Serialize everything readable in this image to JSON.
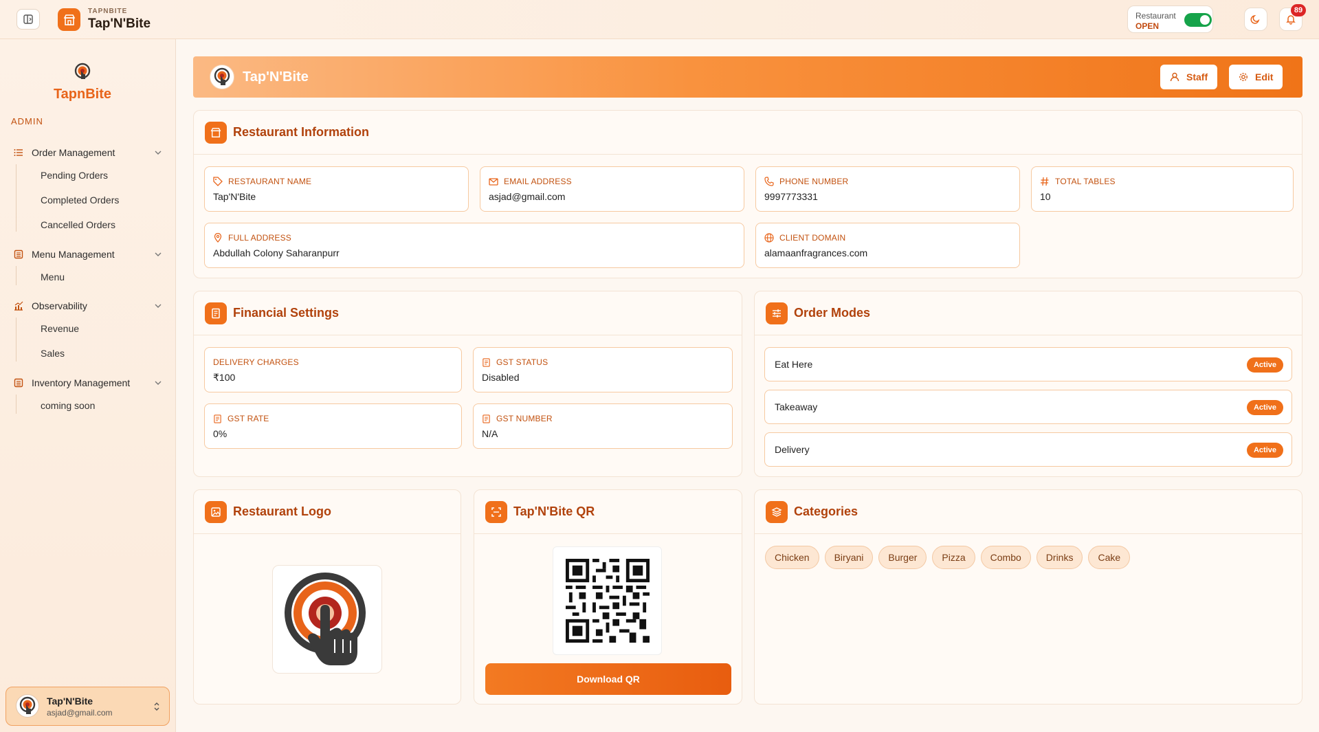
{
  "topbar": {
    "brand_small": "TAPNBITE",
    "brand_name": "Tap'N'Bite",
    "status_label": "Restaurant",
    "status_value": "OPEN",
    "notification_count": "89",
    "accent": "#f0701a"
  },
  "sidebar": {
    "logo_word": "TapnBite",
    "section": "ADMIN",
    "groups": [
      {
        "label": "Order Management",
        "icon": "list-icon",
        "items": [
          "Pending Orders",
          "Completed Orders",
          "Cancelled Orders"
        ]
      },
      {
        "label": "Menu Management",
        "icon": "menu-book-icon",
        "items": [
          "Menu"
        ]
      },
      {
        "label": "Observability",
        "icon": "chart-icon",
        "items": [
          "Revenue",
          "Sales"
        ]
      },
      {
        "label": "Inventory Management",
        "icon": "inventory-icon",
        "items": [
          "coming soon"
        ]
      }
    ],
    "user": {
      "name": "Tap'N'Bite",
      "email": "asjad@gmail.com"
    }
  },
  "hero": {
    "title": "Tap'N'Bite",
    "staff_label": "Staff",
    "edit_label": "Edit"
  },
  "restaurant_info": {
    "title": "Restaurant Information",
    "fields": [
      {
        "label": "RESTAURANT NAME",
        "value": "Tap'N'Bite",
        "icon": "tag-icon"
      },
      {
        "label": "EMAIL ADDRESS",
        "value": "asjad@gmail.com",
        "icon": "mail-icon"
      },
      {
        "label": "PHONE NUMBER",
        "value": "9997773331",
        "icon": "phone-icon"
      },
      {
        "label": "TOTAL TABLES",
        "value": "10",
        "icon": "hash-icon"
      },
      {
        "label": "FULL ADDRESS",
        "value": "Abdullah Colony Saharanpurr",
        "icon": "pin-icon"
      },
      {
        "label": "CLIENT DOMAIN",
        "value": "alamaanfragrances.com",
        "icon": "globe-icon"
      }
    ]
  },
  "financial": {
    "title": "Financial Settings",
    "fields": [
      {
        "label": "DELIVERY CHARGES",
        "value": "₹100"
      },
      {
        "label": "GST STATUS",
        "value": "Disabled"
      },
      {
        "label": "GST RATE",
        "value": "0%"
      },
      {
        "label": "GST NUMBER",
        "value": "N/A"
      }
    ]
  },
  "order_modes": {
    "title": "Order Modes",
    "modes": [
      {
        "label": "Eat Here",
        "status": "Active"
      },
      {
        "label": "Takeaway",
        "status": "Active"
      },
      {
        "label": "Delivery",
        "status": "Active"
      }
    ]
  },
  "logo_card": {
    "title": "Restaurant Logo"
  },
  "qr_card": {
    "title": "Tap'N'Bite QR",
    "button": "Download QR"
  },
  "categories": {
    "title": "Categories",
    "items": [
      "Chicken",
      "Biryani",
      "Burger",
      "Pizza",
      "Combo",
      "Drinks",
      "Cake"
    ]
  }
}
